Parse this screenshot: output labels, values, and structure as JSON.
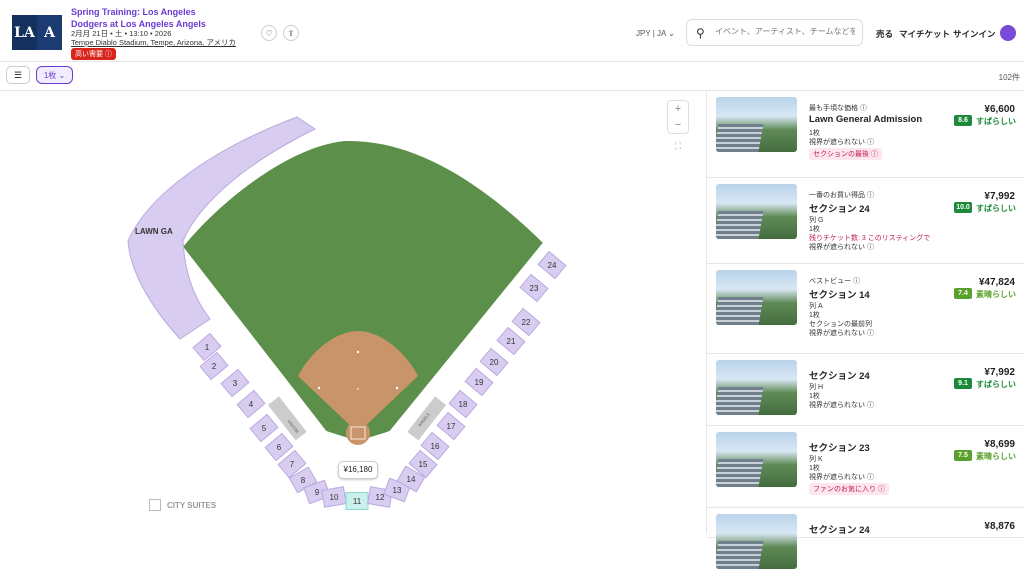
{
  "event": {
    "title_line1": "Spring Training: Los Angeles",
    "title_line2": "Dodgers at Los Angeles Angels",
    "date": "2月月 21日 • 土 • 13:10 • 2026",
    "venue": "Tempe Diablo Stadium, Tempe, Arizona, アメリカ",
    "demand_badge": "高い需要 ⓘ"
  },
  "header": {
    "currency": "JPY | JA ⌄",
    "search_placeholder": "イベント、アーティスト、チームなどを検",
    "sell": "売る",
    "my_tickets": "マイチケット",
    "sign_in": "サインイン"
  },
  "filters": {
    "quantity": "1枚 ⌄",
    "count": "102件"
  },
  "map": {
    "lawn_label": "LAWN GA",
    "suites_label": "CITY SUITES",
    "price_pin": "¥16,180",
    "visitor_label": "VISITOR",
    "angels_label": "ANGELS",
    "sections": [
      "1",
      "2",
      "3",
      "4",
      "5",
      "6",
      "7",
      "8",
      "9",
      "10",
      "11",
      "12",
      "13",
      "14",
      "15",
      "16",
      "17",
      "18",
      "19",
      "20",
      "21",
      "22",
      "23",
      "24"
    ]
  },
  "listings": [
    {
      "tag": "最も手頃な価格 ⓘ",
      "name": "Lawn General Admission",
      "row": "",
      "qty": "1枚",
      "view": "視界が遮られない ⓘ",
      "note": "",
      "extra": "",
      "badge": "セクションの最後 ⓘ",
      "price": "¥6,600",
      "score": "8.6",
      "rating": "すばらしい",
      "level": "high"
    },
    {
      "tag": "一番のお買い得品 ⓘ",
      "name": "セクション 24",
      "row": "列 G",
      "qty": "1枚",
      "view": "視界が遮られない ⓘ",
      "note": "残りチケット数: 3  このリスティングで",
      "extra": "",
      "badge": "",
      "price": "¥7,992",
      "score": "10.0",
      "rating": "すばらしい",
      "level": "high"
    },
    {
      "tag": "ベストビュー ⓘ",
      "name": "セクション 14",
      "row": "列 A",
      "qty": "1枚",
      "view": "視界が遮られない ⓘ",
      "note": "",
      "extra": "セクションの最前列",
      "badge": "",
      "price": "¥47,824",
      "score": "7.4",
      "rating": "素晴らしい",
      "level": "mid"
    },
    {
      "tag": "",
      "name": "セクション 24",
      "row": "列 H",
      "qty": "1枚",
      "view": "視界が遮られない ⓘ",
      "note": "",
      "extra": "",
      "badge": "",
      "price": "¥7,992",
      "score": "9.1",
      "rating": "すばらしい",
      "level": "high"
    },
    {
      "tag": "",
      "name": "セクション 23",
      "row": "列 K",
      "qty": "1枚",
      "view": "視界が遮られない ⓘ",
      "note": "",
      "extra": "",
      "badge": "ファンのお気に入り ⓘ",
      "price": "¥8,699",
      "score": "7.5",
      "rating": "素晴らしい",
      "level": "mid"
    },
    {
      "tag": "",
      "name": "セクション 24",
      "row": "",
      "qty": "",
      "view": "",
      "note": "",
      "extra": "",
      "badge": "",
      "price": "¥8,876",
      "score": "",
      "rating": "",
      "level": "high"
    }
  ]
}
